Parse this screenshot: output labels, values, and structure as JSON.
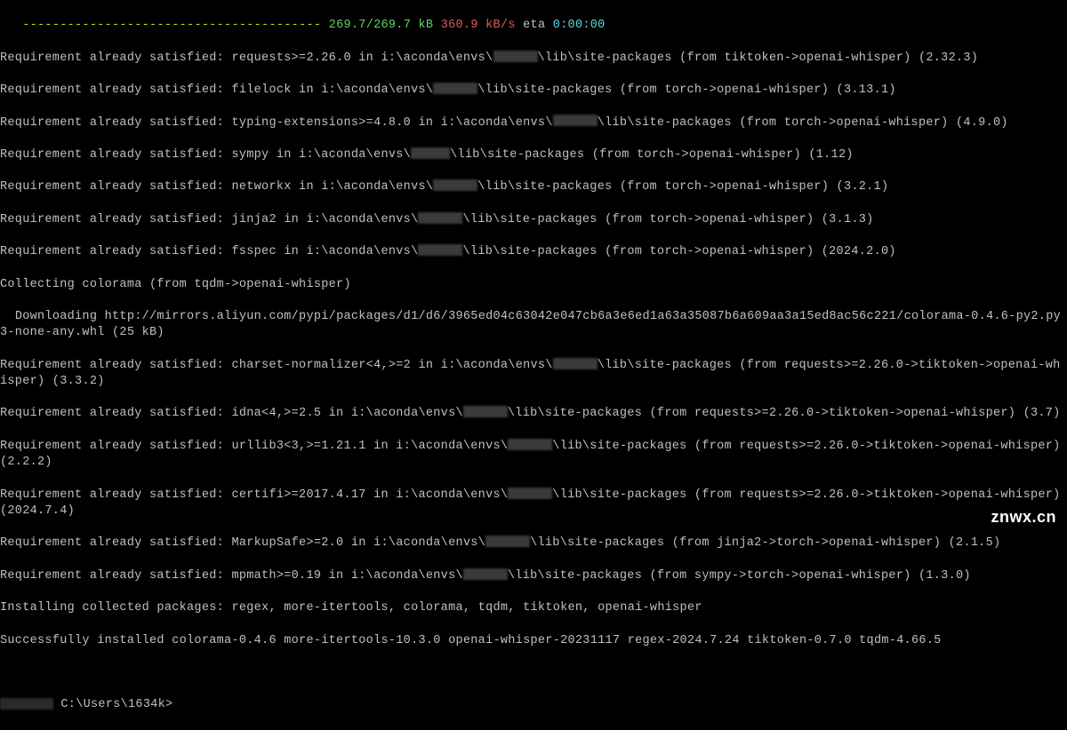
{
  "progress": {
    "dashes": "   ---------------------------------------- ",
    "size": "269.7/269.7 kB",
    "speed": " 360.9 kB/s",
    "eta_label": " eta ",
    "eta_time": "0:00:00"
  },
  "lines": [
    {
      "pre": "Requirement already satisfied: requests>=2.26.0 in i:\\aconda\\envs\\",
      "post": "\\lib\\site-packages (from tiktoken->openai-whisper) (2.32.3)"
    },
    {
      "pre": "Requirement already satisfied: filelock in i:\\aconda\\envs\\",
      "post": "\\lib\\site-packages (from torch->openai-whisper) (3.13.1)"
    },
    {
      "pre": "Requirement already satisfied: typing-extensions>=4.8.0 in i:\\aconda\\envs\\",
      "post": "\\lib\\site-packages (from torch->openai-whisper) (4.9.0)"
    },
    {
      "pre": "Requirement already satisfied: sympy in i:\\aconda\\envs\\",
      "post": "\\lib\\site-packages (from torch->openai-whisper) (1.12)"
    },
    {
      "pre": "Requirement already satisfied: networkx in i:\\aconda\\envs\\",
      "post": "\\lib\\site-packages (from torch->openai-whisper) (3.2.1)"
    },
    {
      "pre": "Requirement already satisfied: jinja2 in i:\\aconda\\envs\\",
      "post": "\\lib\\site-packages (from torch->openai-whisper) (3.1.3)"
    },
    {
      "pre": "Requirement already satisfied: fsspec in i:\\aconda\\envs\\",
      "post": "\\lib\\site-packages (from torch->openai-whisper) (2024.2.0)"
    }
  ],
  "collecting": "Collecting colorama (from tqdm->openai-whisper)",
  "downloading": "  Downloading http://mirrors.aliyun.com/pypi/packages/d1/d6/3965ed04c63042e047cb6a3e6ed1a63a35087b6a609aa3a15ed8ac56c221/colorama-0.4.6-py2.py3-none-any.whl (25 kB)",
  "lines2": [
    {
      "pre": "Requirement already satisfied: charset-normalizer<4,>=2 in i:\\aconda\\envs\\",
      "post": "\\lib\\site-packages (from requests>=2.26.0->tiktoken->openai-whisper) (3.3.2)"
    },
    {
      "pre": "Requirement already satisfied: idna<4,>=2.5 in i:\\aconda\\envs\\",
      "post": "\\lib\\site-packages (from requests>=2.26.0->tiktoken->openai-whisper) (3.7)"
    },
    {
      "pre": "Requirement already satisfied: urllib3<3,>=1.21.1 in i:\\aconda\\envs\\",
      "post": "\\lib\\site-packages (from requests>=2.26.0->tiktoken->openai-whisper) (2.2.2)"
    },
    {
      "pre": "Requirement already satisfied: certifi>=2017.4.17 in i:\\aconda\\envs\\",
      "post": "\\lib\\site-packages (from requests>=2.26.0->tiktoken->openai-whisper) (2024.7.4)"
    },
    {
      "pre": "Requirement already satisfied: MarkupSafe>=2.0 in i:\\aconda\\envs\\",
      "post": "\\lib\\site-packages (from jinja2->torch->openai-whisper) (2.1.5)"
    },
    {
      "pre": "Requirement already satisfied: mpmath>=0.19 in i:\\aconda\\envs\\",
      "post": "\\lib\\site-packages (from sympy->torch->openai-whisper) (1.3.0)"
    }
  ],
  "installing": "Installing collected packages: regex, more-itertools, colorama, tqdm, tiktoken, openai-whisper",
  "success": "Successfully installed colorama-0.4.6 more-itertools-10.3.0 openai-whisper-20231117 regex-2024.7.24 tiktoken-0.7.0 tqdm-4.66.5",
  "prompt": " C:\\Users\\1634k>",
  "watermark": "znwx.cn"
}
